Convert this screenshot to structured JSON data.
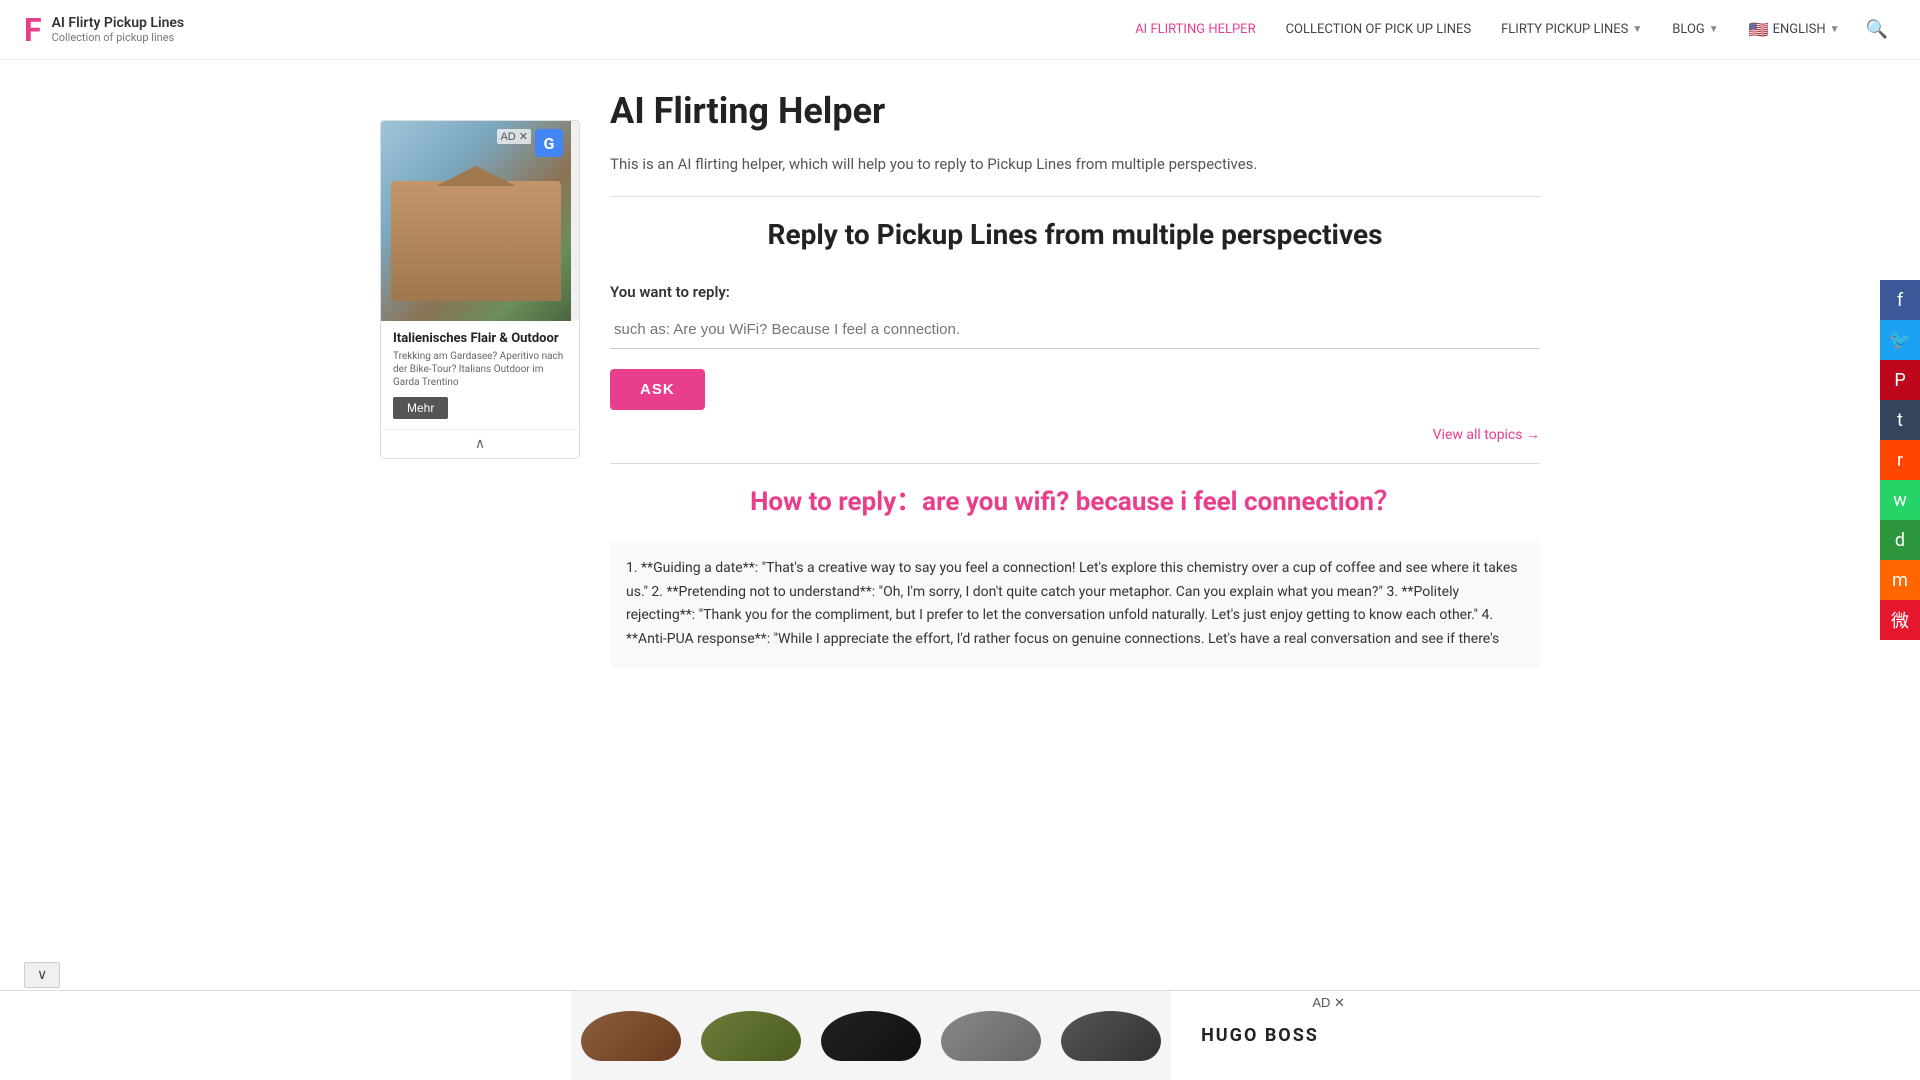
{
  "header": {
    "logo_letter": "F",
    "site_title": "AI Flirty Pickup Lines",
    "site_subtitle": "Collection of pickup lines",
    "nav": [
      {
        "id": "ai-flirting-helper",
        "label": "AI FLIRTING HELPER",
        "active": true,
        "dropdown": false
      },
      {
        "id": "collection",
        "label": "COLLECTION OF PICK UP LINES",
        "active": false,
        "dropdown": false
      },
      {
        "id": "flirty-pickup-lines",
        "label": "FLIRTY PICKUP LINES",
        "active": false,
        "dropdown": true
      },
      {
        "id": "blog",
        "label": "BLOG",
        "active": false,
        "dropdown": true
      },
      {
        "id": "english",
        "label": "ENGLISH",
        "active": false,
        "dropdown": true,
        "flag": "🇺🇸"
      }
    ],
    "search_label": "Search"
  },
  "sidebar_ad": {
    "badge": "G",
    "headline": "Italienisches Flair & Outdoor",
    "body": "Trekking am Gardasee? Aperitivo nach der Bike-Tour? Italians Outdoor im Garda Trentino",
    "button_label": "Mehr",
    "close_label": "AD ✕"
  },
  "main": {
    "page_title": "AI Flirting Helper",
    "intro_text": "This is an AI flirting helper, which will help you to reply to Pickup Lines from multiple perspectives.",
    "section_heading": "Reply to Pickup Lines from multiple perspectives",
    "form_label": "You want to reply:",
    "input_placeholder": "such as: Are you WiFi? Because I feel a connection.",
    "ask_button": "ASK",
    "view_all_label": "View all topics →",
    "result_heading": "How to reply：are you wifi? because i feel connection？",
    "result_text": "1. **Guiding a date**: \"That's a creative way to say you feel a connection! Let's explore this chemistry over a cup of coffee and see where it takes us.\" 2. **Pretending not to understand**: \"Oh, I'm sorry, I don't quite catch your metaphor. Can you explain what you mean?\" 3. **Politely rejecting**: \"Thank you for the compliment, but I prefer to let the conversation unfold naturally. Let's just enjoy getting to know each other.\" 4. **Anti-PUA response**: \"While I appreciate the effort, I'd rather focus on genuine connections. Let's have a real conversation and see if there's"
  },
  "social": {
    "buttons": [
      {
        "id": "facebook",
        "icon": "f",
        "label": "Facebook"
      },
      {
        "id": "twitter",
        "icon": "🐦",
        "label": "Twitter"
      },
      {
        "id": "pinterest",
        "icon": "P",
        "label": "Pinterest"
      },
      {
        "id": "tumblr",
        "icon": "t",
        "label": "Tumblr"
      },
      {
        "id": "reddit",
        "icon": "r",
        "label": "Reddit"
      },
      {
        "id": "whatsapp",
        "icon": "w",
        "label": "WhatsApp"
      },
      {
        "id": "douban",
        "icon": "d",
        "label": "Douban"
      },
      {
        "id": "miaopai",
        "icon": "m",
        "label": "Miaopai"
      },
      {
        "id": "weibo",
        "icon": "微",
        "label": "Weibo"
      }
    ]
  },
  "bottom_ad": {
    "brand": "HUGO BOSS",
    "close_label": "✕",
    "ad_label": "AD ✕",
    "shoes": [
      {
        "color": "brown",
        "alt": "Brown shoe"
      },
      {
        "color": "green",
        "alt": "Green shoe"
      },
      {
        "color": "black-red",
        "alt": "Black red shoe"
      },
      {
        "color": "gray",
        "alt": "Gray shoe"
      },
      {
        "color": "dark",
        "alt": "Dark shoe"
      }
    ]
  },
  "scroll_indicator": {
    "icon": "∨"
  }
}
